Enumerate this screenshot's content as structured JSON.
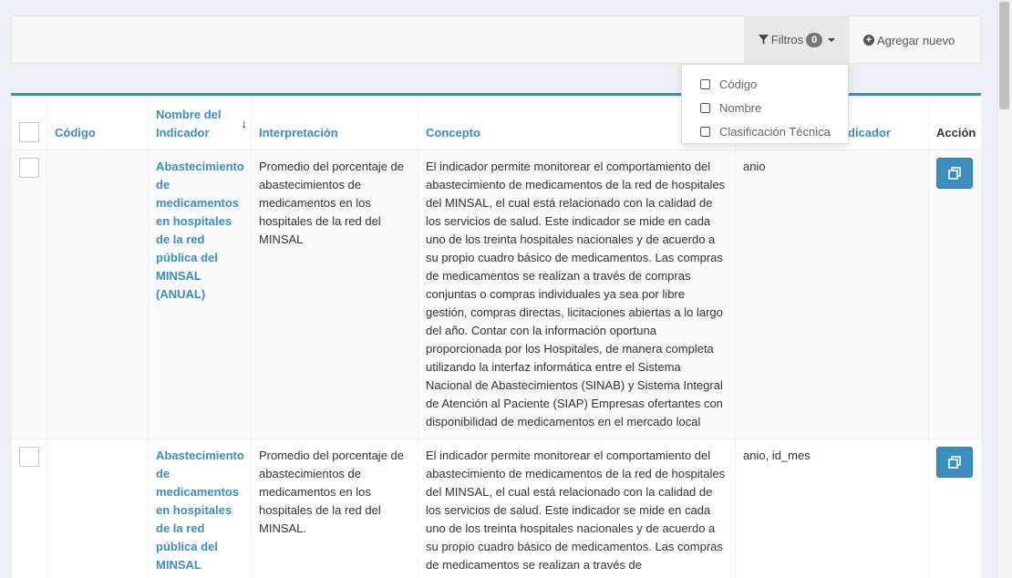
{
  "toolbar": {
    "filter_label": "Filtros",
    "filter_count": "0",
    "add_label": "Agregar nuevo"
  },
  "filter_dropdown": {
    "options": [
      "Código",
      "Nombre",
      "Clasificación Técnica"
    ]
  },
  "table": {
    "headers": {
      "codigo": "Código",
      "nombre_line1": "Nombre del",
      "nombre_line2": "Indicador",
      "interpretacion": "Interpretación",
      "concepto": "Concepto",
      "indicador_partial": "dicador",
      "accion": "Acción"
    },
    "rows": [
      {
        "codigo": "",
        "nombre": "Abastecimiento de medicamentos en hospitales de la red pública del MINSAL (ANUAL)",
        "interpretacion": "Promedio del porcentaje de abastecimientos de medicamentos en los hospitales de la red del MINSAL",
        "concepto": "El indicador permite monitorear el comportamiento del abastecimiento de medicamentos de la red de hospitales del MINSAL, el cual está relacionado con la calidad de los servicios de salud. Este indicador se mide en cada uno de los treinta hospitales nacionales y de acuerdo a su propio cuadro básico de medicamentos. Las compras de medicamentos se realizan a través de compras conjuntas o compras individuales ya sea por libre gestión, compras directas, licitaciones abiertas a lo largo del año. Contar con la información oportuna proporcionada por los Hospitales, de manera completa utilizando la interfaz informática entre el Sistema Nacional de Abastecimientos (SINAB) y Sistema Integral de Atención al Paciente (SIAP) Empresas ofertantes con disponibilidad de medicamentos en el mercado local",
        "indicador": "anio"
      },
      {
        "codigo": "",
        "nombre": "Abastecimiento de medicamentos en hospitales de la red pública del MINSAL",
        "interpretacion": "Promedio del porcentaje de abastecimientos de medicamentos en los hospitales de la red del MINSAL.",
        "concepto": "El indicador permite monitorear el comportamiento del abastecimiento de medicamentos de la red de hospitales del MINSAL, el cual está relacionado con la calidad de los servicios de salud. Este indicador se mide en cada uno de los treinta hospitales nacionales y de acuerdo a su propio cuadro básico de medicamentos. Las compras de medicamentos se realizan a través de",
        "indicador": "anio, id_mes"
      }
    ]
  },
  "colors": {
    "accent": "#3c8dbc",
    "badge": "#777777"
  },
  "icons": {
    "filter": "funnel-icon",
    "add": "plus-circle-icon",
    "sort": "arrow-down-icon",
    "copy": "copy-icon"
  }
}
